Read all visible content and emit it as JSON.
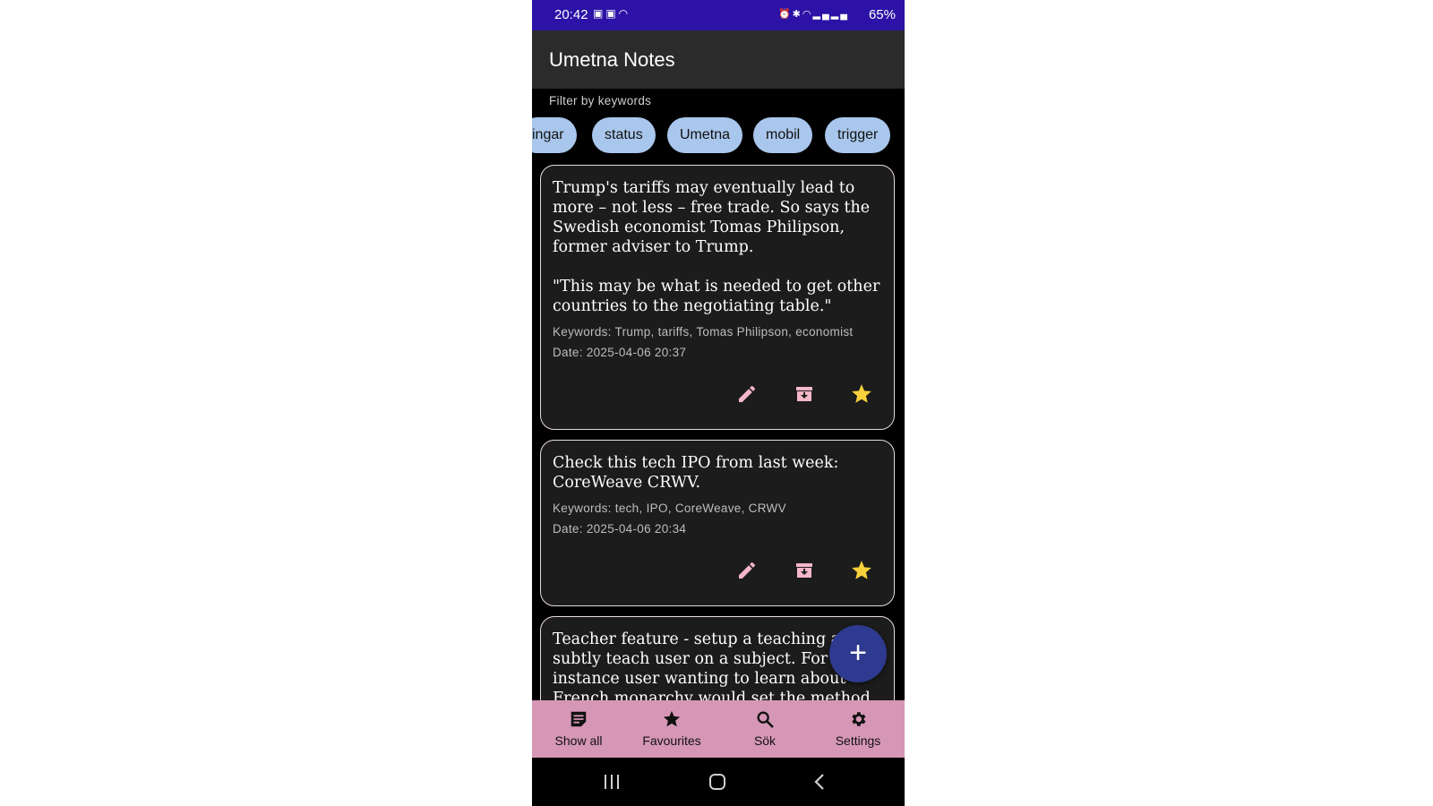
{
  "status_bar": {
    "time": "20:42",
    "battery": "65%"
  },
  "app": {
    "title": "Umetna Notes",
    "filter_label": "Filter by keywords"
  },
  "keyword_chips": [
    "ingar",
    "status",
    "Umetna",
    "mobil",
    "trigger"
  ],
  "notes": [
    {
      "text": "Trump's tariffs may eventually lead to more – not less – free trade. So says the Swedish economist Tomas Philipson, former adviser to Trump.\n\n\"This may be what is needed to get other countries to the negotiating table.\"",
      "keywords": "Keywords: Trump, tariffs, Tomas Philipson, economist",
      "date": "Date: 2025-04-06 20:37"
    },
    {
      "text": "Check this tech IPO from last week: CoreWeave CRWV.",
      "keywords": "Keywords: tech, IPO, CoreWeave, CRWV",
      "date": "Date: 2025-04-06 20:34"
    },
    {
      "text": "Teacher feature - setup a teaching ai will subtly teach user on a subject. For instance user wanting to learn about French monarchy would set the method"
    }
  ],
  "fab": {
    "label": "+"
  },
  "bottom_nav": [
    {
      "label": "Show all",
      "icon": "notes-icon"
    },
    {
      "label": "Favourites",
      "icon": "star-icon"
    },
    {
      "label": "Sök",
      "icon": "search-icon"
    },
    {
      "label": "Settings",
      "icon": "gear-icon"
    }
  ],
  "colors": {
    "status_bar": "#2c12a6",
    "app_bar": "#2b2b2b",
    "chip": "#a9c7ec",
    "card": "#1c1c1c",
    "action_icon": "#f4b6c8",
    "favourite_star": "#f7d13b",
    "fab": "#2e3a8f",
    "bottom_nav": "#d697b6"
  }
}
